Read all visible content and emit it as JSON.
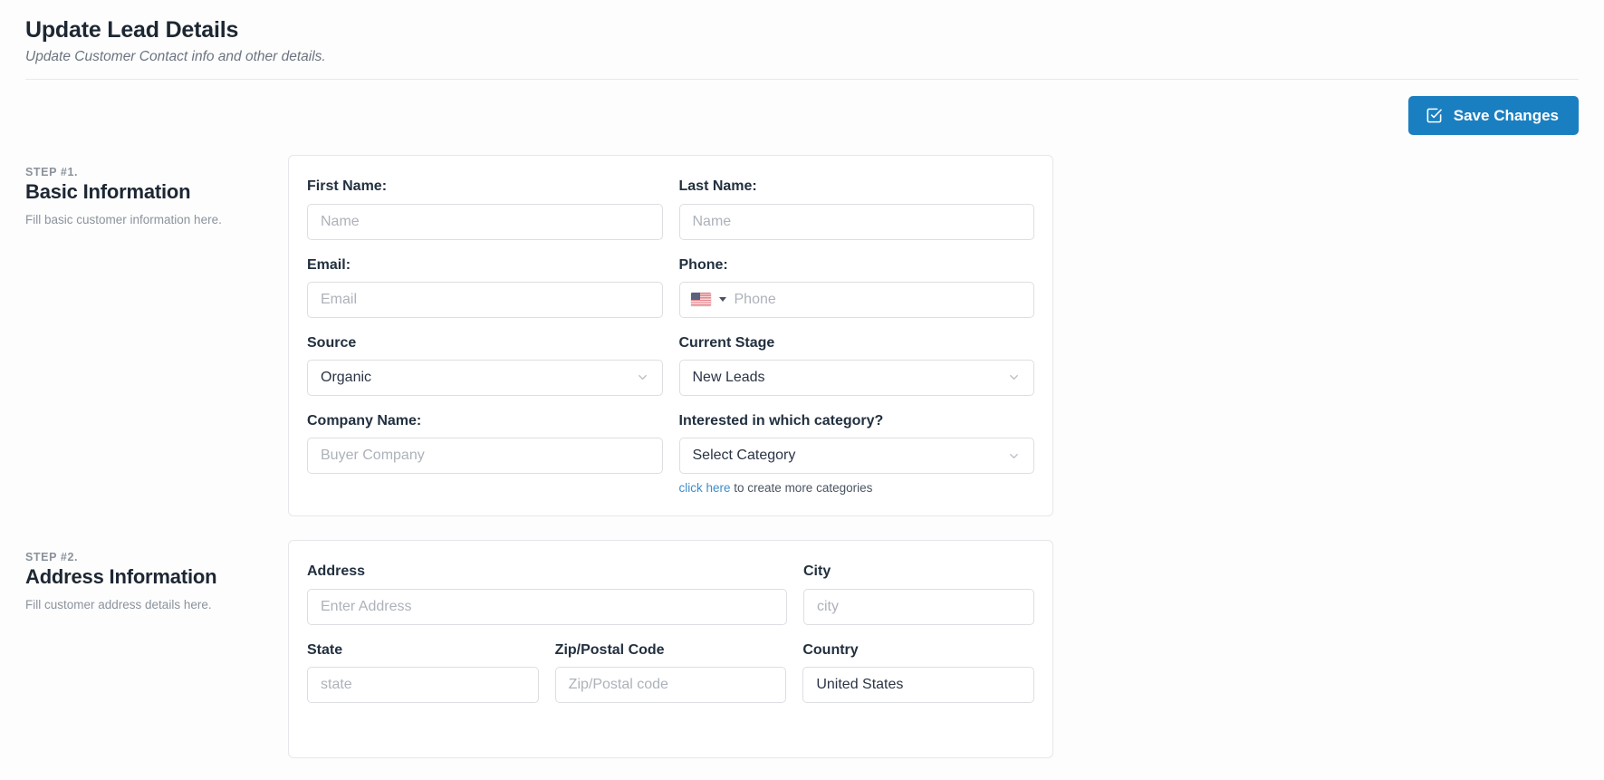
{
  "header": {
    "title": "Update Lead Details",
    "subtitle": "Update Customer Contact info and other details."
  },
  "toolbar": {
    "save_label": "Save Changes",
    "save_icon": "check-square-icon",
    "accent_color": "#1a7fc1"
  },
  "steps": [
    {
      "kicker": "STEP #1.",
      "heading": "Basic Information",
      "description": "Fill basic customer information here."
    },
    {
      "kicker": "STEP #2.",
      "heading": "Address Information",
      "description": "Fill customer address details here."
    }
  ],
  "basic_information": {
    "first_name": {
      "label": "First Name:",
      "value": "",
      "placeholder": "Name"
    },
    "last_name": {
      "label": "Last Name:",
      "value": "",
      "placeholder": "Name"
    },
    "email": {
      "label": "Email:",
      "value": "",
      "placeholder": "Email"
    },
    "phone": {
      "label": "Phone:",
      "value": "",
      "placeholder": "Phone",
      "country_flag": "us-flag-icon"
    },
    "source": {
      "label": "Source",
      "value": "Organic",
      "caret": "chevron-down-icon"
    },
    "current_stage": {
      "label": "Current Stage",
      "value": "New Leads",
      "caret": "chevron-down-icon"
    },
    "company_name": {
      "label": "Company Name:",
      "value": "",
      "placeholder": "Buyer Company"
    },
    "category": {
      "label": "Interested in which category?",
      "value": "Select Category",
      "caret": "chevron-down-icon",
      "hint_link": "click here",
      "hint_text": " to create more categories",
      "link_color": "#3d8ecb"
    }
  },
  "address_information": {
    "address": {
      "label": "Address",
      "value": "",
      "placeholder": "Enter Address"
    },
    "city": {
      "label": "City",
      "value": "",
      "placeholder": "city"
    },
    "state": {
      "label": "State",
      "value": "",
      "placeholder": "state"
    },
    "zip": {
      "label": "Zip/Postal Code",
      "value": "",
      "placeholder": "Zip/Postal code"
    },
    "country": {
      "label": "Country",
      "value": "United States",
      "placeholder": ""
    }
  }
}
